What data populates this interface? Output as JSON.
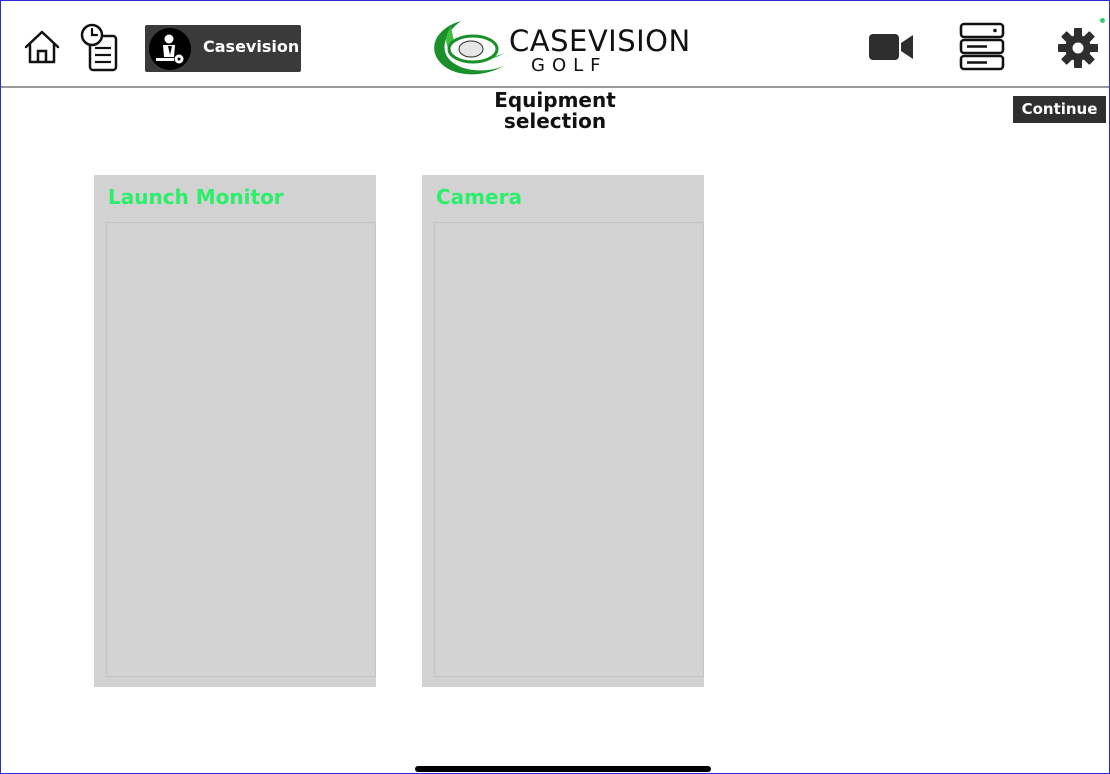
{
  "header": {
    "user": {
      "name": "Casevision"
    },
    "logo": {
      "main": "CASEVISION",
      "sub": "GOLF"
    },
    "icons": [
      "home-icon",
      "history-icon",
      "user-avatar-icon",
      "video-camera-icon",
      "server-icon",
      "gear-icon"
    ]
  },
  "page": {
    "title_line1": "Equipment",
    "title_line2": "selection",
    "continue_label": "Continue"
  },
  "panels": [
    {
      "title": "Launch Monitor"
    },
    {
      "title": "Camera"
    }
  ],
  "colors": {
    "panel_title": "#2bef6a",
    "panel_bg": "#d2d2d2",
    "button_bg": "#2f2f2f",
    "frame": "#2b2bd6"
  }
}
